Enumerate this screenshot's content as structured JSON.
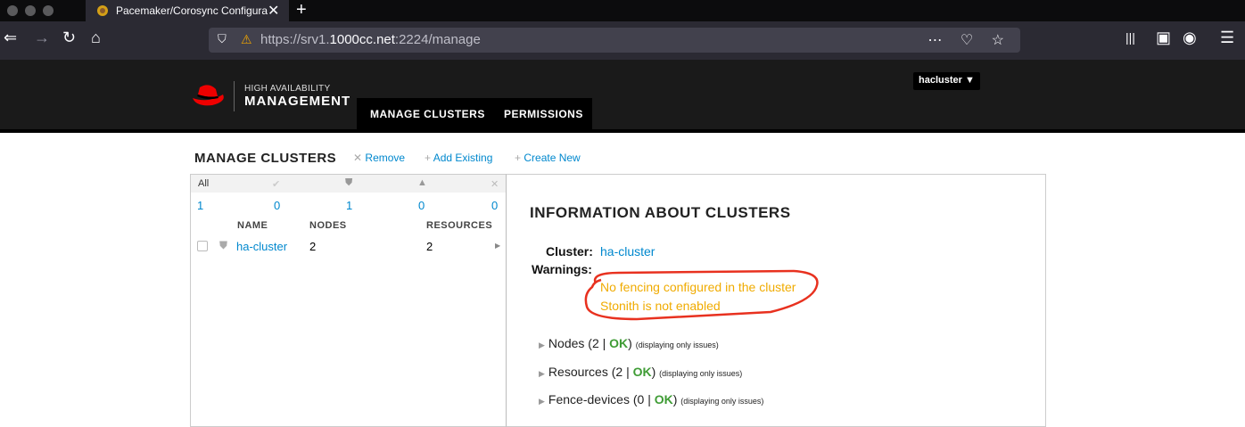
{
  "browser": {
    "tab_title": "Pacemaker/Corosync Configura",
    "tab_close": "✕",
    "new_tab": "+",
    "url_prefix": "https://srv1.",
    "url_domain": "1000cc.net",
    "url_suffix": ":2224/manage"
  },
  "header": {
    "logo_line1": "HIGH AVAILABILITY",
    "logo_line2": "MANAGEMENT",
    "nav": [
      "MANAGE CLUSTERS",
      "PERMISSIONS"
    ],
    "user": "hacluster ▼",
    "brand_color": "#ee0000"
  },
  "manage": {
    "title": "MANAGE CLUSTERS",
    "actions": [
      {
        "icon": "✕",
        "label": "Remove"
      },
      {
        "icon": "+",
        "label": "Add Existing"
      },
      {
        "icon": "+",
        "label": "Create New"
      }
    ],
    "filters": {
      "all_label": "All",
      "counts": [
        "1",
        "0",
        "1",
        "0",
        "0"
      ]
    },
    "columns": [
      "NAME",
      "NODES",
      "RESOURCES"
    ],
    "rows": [
      {
        "name": "ha-cluster",
        "nodes": "2",
        "resources": "2"
      }
    ]
  },
  "info": {
    "title": "INFORMATION ABOUT CLUSTERS",
    "cluster_label": "Cluster:",
    "cluster_name": "ha-cluster",
    "warnings_label": "Warnings:",
    "warnings": [
      "No fencing configured in the cluster",
      "Stonith is not enabled"
    ],
    "sections": [
      {
        "name": "Nodes (2 ",
        "sep": "|",
        "status": "OK",
        "close": ")",
        "note": "(displaying only issues)"
      },
      {
        "name": "Resources (2 ",
        "sep": "|",
        "status": "OK",
        "close": ")",
        "note": "(displaying only issues)"
      },
      {
        "name": "Fence-devices (0 ",
        "sep": "|",
        "status": "OK",
        "close": ")",
        "note": "(displaying only issues)"
      }
    ],
    "warning_color": "#f0ab00",
    "ok_color": "#3f9c35"
  }
}
